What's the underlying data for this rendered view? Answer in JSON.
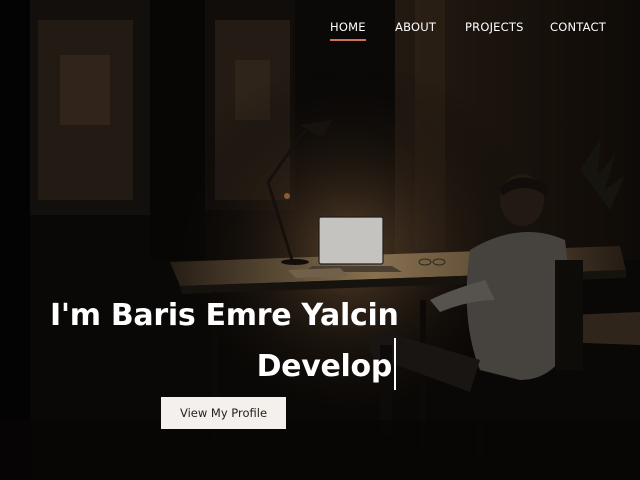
{
  "nav": {
    "items": [
      {
        "label": "HOME",
        "active": true
      },
      {
        "label": "ABOUT",
        "active": false
      },
      {
        "label": "PROJECTS",
        "active": false
      },
      {
        "label": "CONTACT",
        "active": false
      }
    ],
    "active_underline_color": "#d0715a"
  },
  "hero": {
    "headline_line1": "I'm Baris Emre Yalcin",
    "headline_line2": "Develop",
    "cta_label": "View My Profile"
  }
}
